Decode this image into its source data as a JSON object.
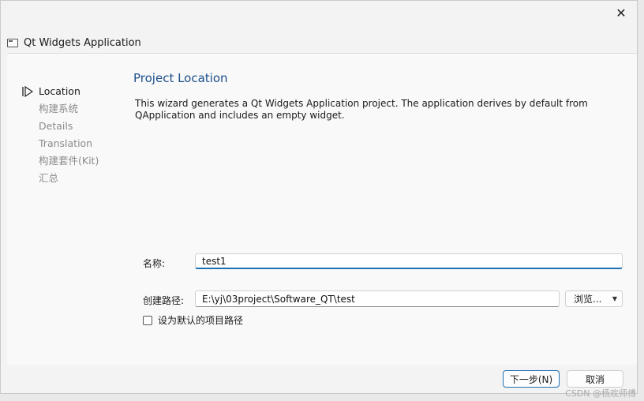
{
  "window": {
    "title": "Qt Widgets Application"
  },
  "icons": {
    "close": "close-icon",
    "app": "app-window-icon",
    "step": "play-arrow-icon"
  },
  "steps": [
    {
      "label": "Location",
      "active": true
    },
    {
      "label": "构建系统",
      "active": false
    },
    {
      "label": "Details",
      "active": false
    },
    {
      "label": "Translation",
      "active": false
    },
    {
      "label": "构建套件(Kit)",
      "active": false
    },
    {
      "label": "汇总",
      "active": false
    }
  ],
  "page": {
    "title": "Project Location",
    "description_line1": "This wizard generates a Qt Widgets Application project. The application derives by default from",
    "description_line2": "QApplication and includes an empty widget."
  },
  "form": {
    "name_label": "名称:",
    "name_value": "test1",
    "path_label": "创建路径:",
    "path_value": "E:\\yj\\03project\\Software_QT\\test",
    "browse_label": "浏览...",
    "default_path_label": "设为默认的项目路径",
    "default_path_checked": false
  },
  "buttons": {
    "next": "下一步(N)",
    "cancel": "取消"
  },
  "watermark": "CSDN @杨欢师傅",
  "colors": {
    "accent": "#1f6fb3",
    "title": "#1b4f8a"
  }
}
